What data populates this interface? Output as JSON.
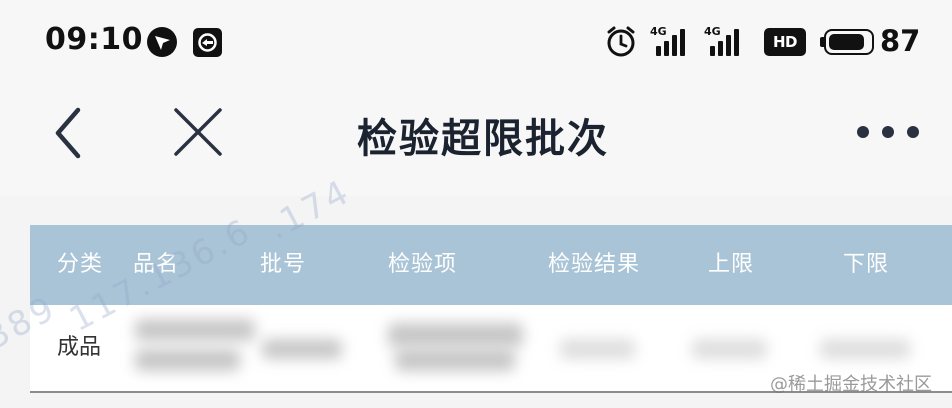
{
  "status_bar": {
    "time": "09:10",
    "left_icons": [
      "navigation-arrow-icon",
      "app-square-icon"
    ],
    "right_icons": [
      "alarm-icon",
      "signal-4g-icon",
      "signal-4g-icon",
      "hd-voice-icon",
      "battery-icon"
    ],
    "signal_label_1": "4G",
    "signal_label_2": "4G",
    "hd_label": "HD",
    "battery": "87",
    "battery_level": 0.87
  },
  "nav": {
    "title": "检验超限批次",
    "back_icon": "chevron-left-icon",
    "close_icon": "close-icon",
    "more_icon": "more-dots-icon"
  },
  "table": {
    "header_bg": "#a9c4d6",
    "columns": [
      "分类",
      "品名",
      "批号",
      "检验项",
      "检验结果",
      "上限",
      "下限"
    ],
    "rows": [
      {
        "category": "成品"
      }
    ]
  },
  "watermark": {
    "segments": [
      "389",
      "117.136.6",
      ".174"
    ],
    "platform": "@稀土掘金技术社区"
  }
}
